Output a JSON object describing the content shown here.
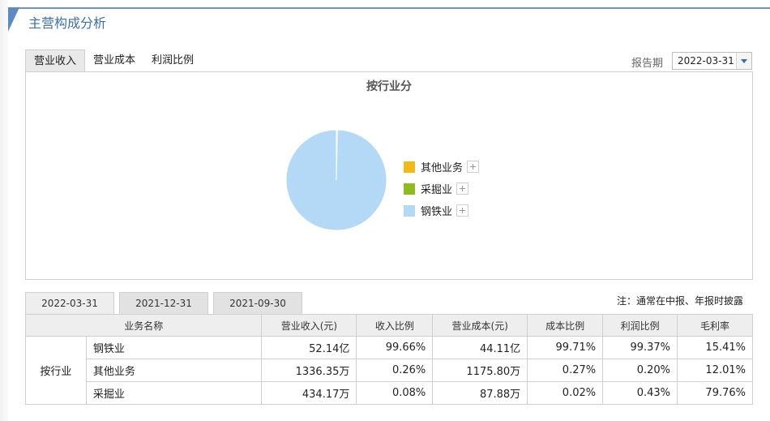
{
  "section": {
    "title": "主营构成分析"
  },
  "tabs": [
    {
      "label": "营业收入",
      "active": true
    },
    {
      "label": "营业成本",
      "active": false
    },
    {
      "label": "利润比例",
      "active": false
    }
  ],
  "period": {
    "label": "报告期",
    "selected": "2022-03-31"
  },
  "chart": {
    "title": "按行业分",
    "legend": [
      {
        "label": "其他业务",
        "color": "#f2b918"
      },
      {
        "label": "采掘业",
        "color": "#8cbc1e"
      },
      {
        "label": "钢铁业",
        "color": "#b3d9f7"
      }
    ]
  },
  "chart_data": {
    "type": "pie",
    "title": "按行业分",
    "categories": [
      "钢铁业",
      "其他业务",
      "采掘业"
    ],
    "values": [
      99.66,
      0.26,
      0.08
    ],
    "colors": [
      "#b3d9f7",
      "#f2b918",
      "#8cbc1e"
    ],
    "legend_position": "right"
  },
  "date_tabs": [
    {
      "label": "2022-03-31",
      "active": true
    },
    {
      "label": "2021-12-31",
      "active": false
    },
    {
      "label": "2021-09-30",
      "active": false
    }
  ],
  "note": "注：通常在中报、年报时披露",
  "table": {
    "headers": [
      "业务名称",
      "营业收入(元)",
      "收入比例",
      "营业成本(元)",
      "成本比例",
      "利润比例",
      "毛利率"
    ],
    "group": "按行业",
    "rows": [
      {
        "name": "钢铁业",
        "revenue": "52.14亿",
        "revenue_ratio": "99.66%",
        "cost": "44.11亿",
        "cost_ratio": "99.71%",
        "profit_ratio": "99.37%",
        "margin": "15.41%"
      },
      {
        "name": "其他业务",
        "revenue": "1336.35万",
        "revenue_ratio": "0.26%",
        "cost": "1175.80万",
        "cost_ratio": "0.27%",
        "profit_ratio": "0.20%",
        "margin": "12.01%"
      },
      {
        "name": "采掘业",
        "revenue": "434.17万",
        "revenue_ratio": "0.08%",
        "cost": "87.88万",
        "cost_ratio": "0.02%",
        "profit_ratio": "0.43%",
        "margin": "79.76%"
      }
    ]
  }
}
